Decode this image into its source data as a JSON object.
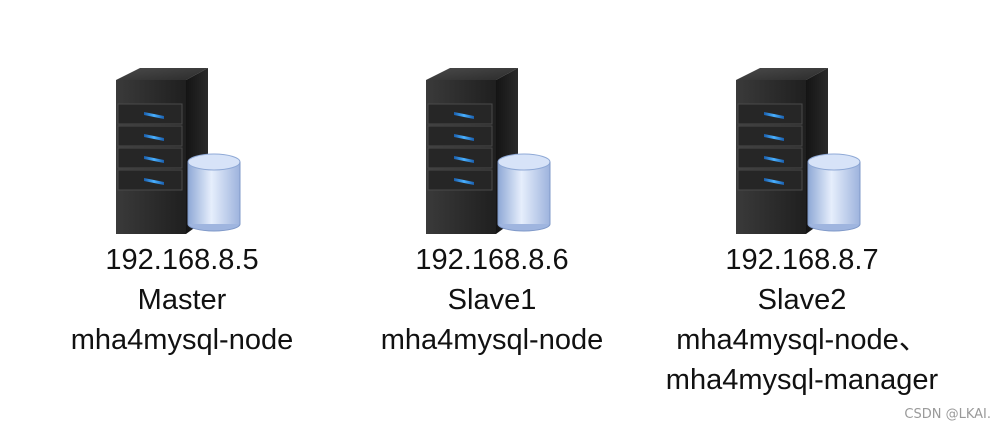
{
  "nodes": [
    {
      "ip": "192.168.8.5",
      "role": "Master",
      "software": [
        "mha4mysql-node"
      ],
      "icon": "mysql-server-icon"
    },
    {
      "ip": "192.168.8.6",
      "role": "Slave1",
      "software": [
        "mha4mysql-node"
      ],
      "icon": "mysql-server-icon"
    },
    {
      "ip": "192.168.8.7",
      "role": "Slave2",
      "software": [
        "mha4mysql-node、",
        "mha4mysql-manager"
      ],
      "icon": "mysql-server-icon"
    }
  ],
  "watermark": "CSDN @LKAI.",
  "colors": {
    "server_body": "#2b2b2b",
    "server_light": "#2f8fe6",
    "database": "#b9cceb"
  }
}
